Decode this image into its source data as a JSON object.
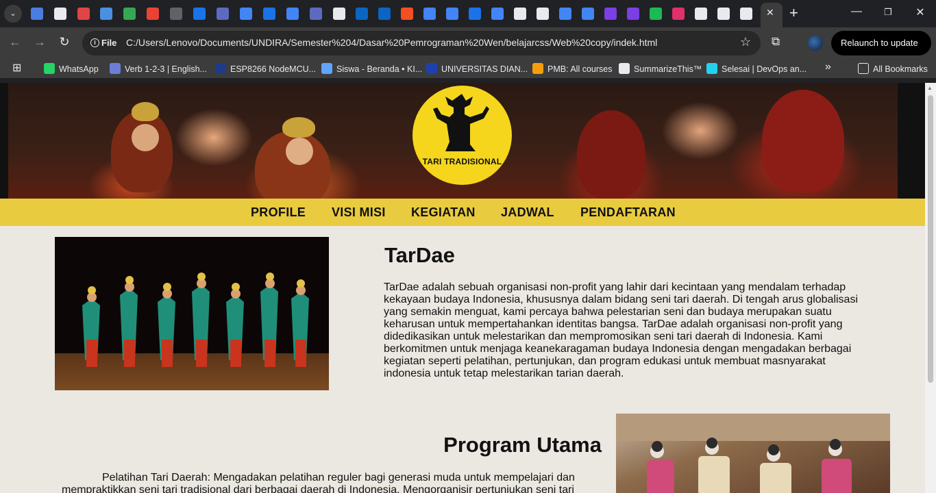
{
  "browser": {
    "url_scheme_label": "File",
    "url": "C:/Users/Lenovo/Documents/UNDIRA/Semester%204/Dasar%20Pemrograman%20Wen/belajarcss/Web%20copy/indek.html",
    "relaunch_label": "Relaunch to update",
    "tab_favicon_colors": [
      "#4a7de0",
      "#e8eaed",
      "#e04545",
      "#4a90e2",
      "#34a853",
      "#ea4335",
      "#5f6368",
      "#1a73e8",
      "#5c6bc0",
      "#4285f4",
      "#1a73e8",
      "#4285f4",
      "#5c6bc0",
      "#e8eaed",
      "#0a66c2",
      "#0a66c2",
      "#f25022",
      "#4285f4",
      "#4285f4",
      "#1a73e8",
      "#4285f4",
      "#e8eaed",
      "#e8eaed",
      "#4285f4",
      "#4285f4",
      "#7b3fe4",
      "#7b3fe4",
      "#1db954",
      "#e1306c",
      "#e8eaed",
      "#e8eaed",
      "#e8eaed"
    ],
    "bookmarks": [
      {
        "label": "WhatsApp",
        "color": "#25d366"
      },
      {
        "label": "Verb 1-2-3 | English...",
        "color": "#6b7fd7"
      },
      {
        "label": "ESP8266 NodeMCU...",
        "color": "#1e3a8a"
      },
      {
        "label": "Siswa - Beranda • KI...",
        "color": "#60a5fa"
      },
      {
        "label": "UNIVERSITAS DIAN...",
        "color": "#1e40af"
      },
      {
        "label": "PMB: All courses",
        "color": "#f59e0b"
      },
      {
        "label": "SummarizeThis™",
        "color": "#e8eaed"
      },
      {
        "label": "Selesai | DevOps an...",
        "color": "#22d3ee"
      }
    ],
    "all_bookmarks_label": "All Bookmarks"
  },
  "page": {
    "logo_text": "TARI TRADISIONAL",
    "nav": [
      "PROFILE",
      "VISI MISI",
      "KEGIATAN",
      "JADWAL",
      "PENDAFTARAN"
    ],
    "title": "TarDae",
    "description": "TarDae adalah sebuah organisasi non-profit yang lahir dari kecintaan yang mendalam terhadap kekayaan budaya Indonesia, khususnya dalam bidang seni tari daerah. Di tengah arus globalisasi yang semakin menguat, kami percaya bahwa pelestarian seni dan budaya merupakan suatu keharusan untuk mempertahankan identitas bangsa. TarDae adalah organisasi non-profit yang didedikasikan untuk melestarikan dan mempromosikan seni tari daerah di Indonesia. Kami berkomitmen untuk menjaga keanekaragaman budaya Indonesia dengan mengadakan berbagai kegiatan seperti pelatihan, pertunjukan, dan program edukasi untuk membuat masnyarakat indonesia untuk tetap melestarikan tarian daerah.",
    "program_title": "Program Utama",
    "program_text": "Pelatihan Tari Daerah: Mengadakan pelatihan reguler bagi generasi muda untuk mempelajari dan mempraktikkan seni tari tradisional dari berbagai daerah di Indonesia. Mengorganisir pertunjukan seni tari"
  },
  "colors": {
    "nav_bg": "#e9cb3f",
    "logo_bg": "#f5d61c",
    "page_bg": "#ebe7e1"
  }
}
